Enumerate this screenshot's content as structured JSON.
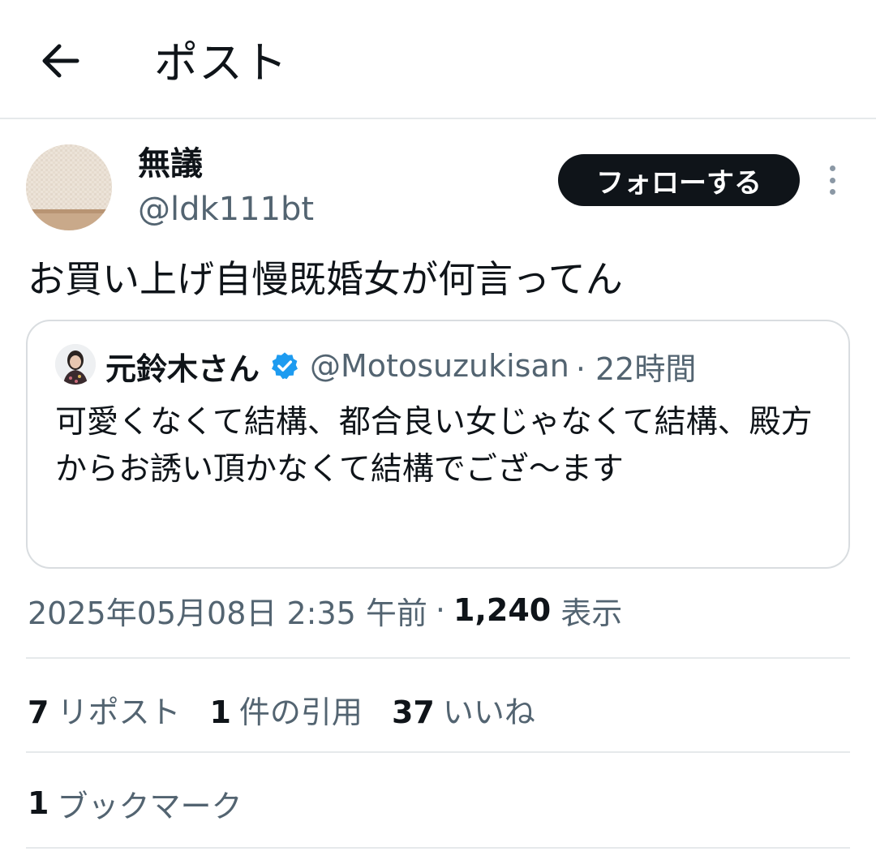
{
  "header": {
    "title": "ポスト",
    "back_icon": "arrow-left-icon"
  },
  "post": {
    "author": {
      "display_name": "無議",
      "handle": "@ldk111bt"
    },
    "follow_label": "フォローする",
    "text": "お買い上げ自慢既婚女が何言ってん",
    "quoted": {
      "display_name": "元鈴木さん",
      "verified_icon": "verified-badge-icon",
      "handle": "@Motosuzukisan",
      "time": "· 22時間",
      "text": "可愛くなくて結構、都合良い女じゃなくて結構、殿方からお誘い頂かなくて結構でござ〜ます"
    },
    "meta": {
      "timestamp": "2025年05月08日 2:35 午前",
      "separator": "·",
      "views": "1,240",
      "views_label": "表示"
    },
    "stats": {
      "reposts": "7",
      "reposts_label": "リポスト",
      "quotes": "1",
      "quotes_label": "件の引用",
      "likes": "37",
      "likes_label": "いいね"
    },
    "bookmarks": {
      "count": "1",
      "label": "ブックマーク"
    }
  },
  "colors": {
    "text_primary": "#0f1419",
    "text_secondary": "#536471",
    "border": "#e6e9eb",
    "verified_blue": "#1d9bf0",
    "follow_bg": "#0f1419"
  }
}
